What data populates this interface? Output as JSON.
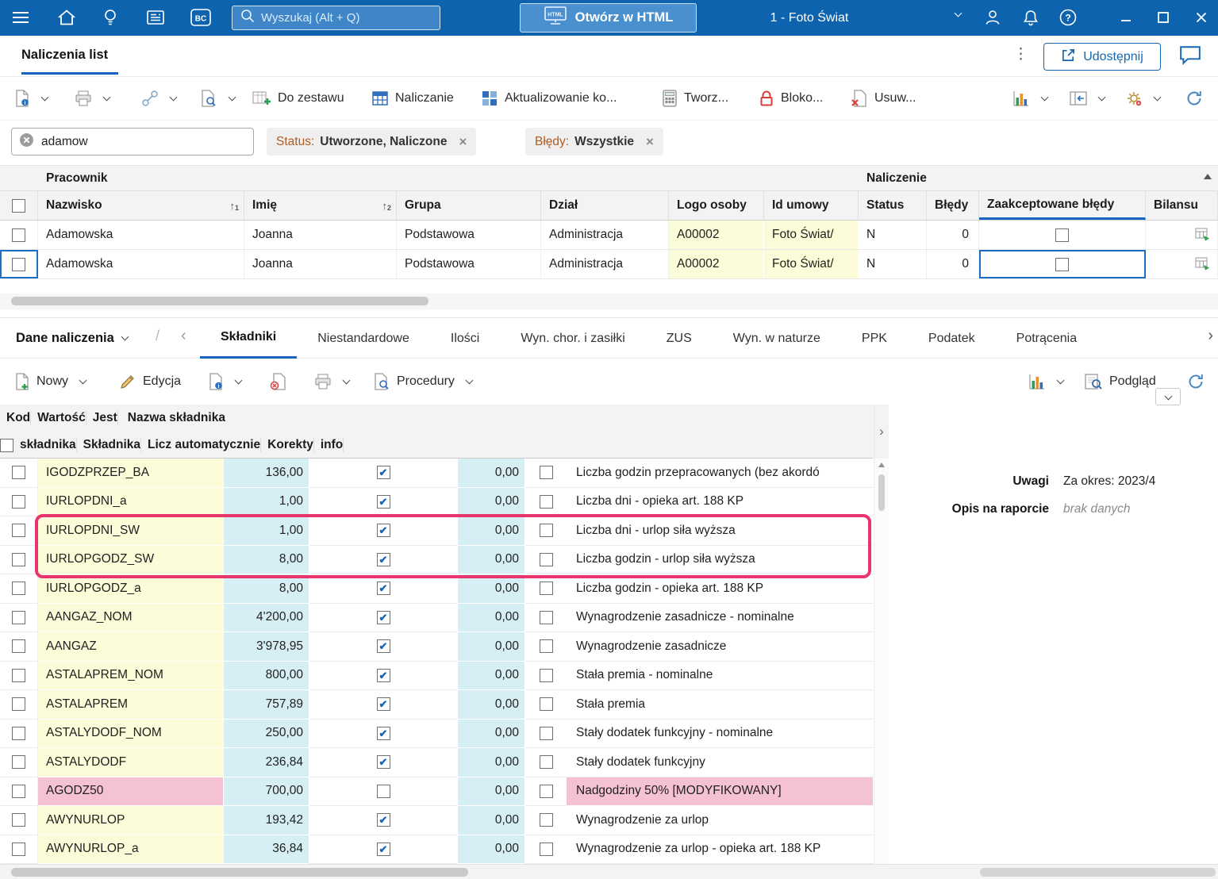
{
  "topbar": {
    "search": {
      "placeholder": "Wyszukaj (Alt + Q)"
    },
    "open_html": "Otwórz w HTML",
    "company": "1 - Foto Świat"
  },
  "header": {
    "tab": "Naliczenia list",
    "share": "Udostępnij"
  },
  "toolbar": {
    "items": [
      "Do zestawu",
      "Naliczanie",
      "Aktualizowanie ko...",
      "Tworz...",
      "Bloko...",
      "Usuw..."
    ]
  },
  "filters": {
    "search_value": "adamow",
    "chips": [
      {
        "name": "Status:",
        "value": "Utworzone, Naliczone"
      },
      {
        "name": "Błędy:",
        "value": "Wszystkie"
      }
    ]
  },
  "employees": {
    "groups": {
      "pracownik": "Pracownik",
      "naliczenie": "Naliczenie"
    },
    "columns": {
      "nazwisko": "Nazwisko",
      "imie": "Imię",
      "grupa": "Grupa",
      "dzial": "Dział",
      "logo": "Logo osoby",
      "umowa": "Id umowy",
      "status": "Status",
      "bledy": "Błędy",
      "zaakceptowane": "Zaakceptowane błędy",
      "bilans": "Bilansu"
    },
    "rows": [
      {
        "nazwisko": "Adamowska",
        "imie": "Joanna",
        "grupa": "Podstawowa",
        "dzial": "Administracja",
        "logo": "A00002",
        "umowa": "Foto Świat/",
        "status": "N",
        "bledy": "0",
        "zaakceptowane_checked": false,
        "selected": false
      },
      {
        "nazwisko": "Adamowska",
        "imie": "Joanna",
        "grupa": "Podstawowa",
        "dzial": "Administracja",
        "logo": "A00002",
        "umowa": "Foto Świat/",
        "status": "N",
        "bledy": "0",
        "zaakceptowane_checked": false,
        "selected": true
      }
    ]
  },
  "detail": {
    "title": "Dane naliczenia",
    "tabs": [
      "Składniki",
      "Niestandardowe",
      "Ilości",
      "Wyn. chor. i zasiłki",
      "ZUS",
      "Wyn. w naturze",
      "PPK",
      "Podatek",
      "Potrącenia"
    ],
    "active_tab": "Składniki",
    "toolbar": {
      "nowy": "Nowy",
      "edycja": "Edycja",
      "procedury": "Procedury",
      "podglad": "Podgląd"
    }
  },
  "components": {
    "headers": {
      "kod1": "Kod",
      "kod2": "składnika",
      "wartosc": "Wartość",
      "skladnika": "Składnika",
      "licz": "Licz automatycznie",
      "korekty": "Korekty",
      "jest1": "Jest",
      "jest2": "info",
      "nazwa": "Nazwa składnika"
    },
    "rows": [
      {
        "kod": "IGODZPRZEP_BA",
        "wartosc": "136,00",
        "licz": true,
        "korekty": "0,00",
        "info": false,
        "nazwa": "Liczba godzin przepracowanych (bez akordó",
        "pink": false
      },
      {
        "kod": "IURLOPDNI_a",
        "wartosc": "1,00",
        "licz": true,
        "korekty": "0,00",
        "info": false,
        "nazwa": "Liczba dni - opieka art. 188 KP",
        "pink": false
      },
      {
        "kod": "IURLOPDNI_SW",
        "wartosc": "1,00",
        "licz": true,
        "korekty": "0,00",
        "info": false,
        "nazwa": "Liczba dni - urlop siła wyższa",
        "pink": false
      },
      {
        "kod": "IURLOPGODZ_SW",
        "wartosc": "8,00",
        "licz": true,
        "korekty": "0,00",
        "info": false,
        "nazwa": "Liczba godzin - urlop siła wyższa",
        "pink": false
      },
      {
        "kod": "IURLOPGODZ_a",
        "wartosc": "8,00",
        "licz": true,
        "korekty": "0,00",
        "info": false,
        "nazwa": "Liczba godzin - opieka art. 188 KP",
        "pink": false
      },
      {
        "kod": "AANGAZ_NOM",
        "wartosc": "4'200,00",
        "licz": true,
        "korekty": "0,00",
        "info": false,
        "nazwa": "Wynagrodzenie zasadnicze - nominalne",
        "pink": false
      },
      {
        "kod": "AANGAZ",
        "wartosc": "3'978,95",
        "licz": true,
        "korekty": "0,00",
        "info": false,
        "nazwa": "Wynagrodzenie zasadnicze",
        "pink": false
      },
      {
        "kod": "ASTALAPREM_NOM",
        "wartosc": "800,00",
        "licz": true,
        "korekty": "0,00",
        "info": false,
        "nazwa": "Stała premia - nominalne",
        "pink": false
      },
      {
        "kod": "ASTALAPREM",
        "wartosc": "757,89",
        "licz": true,
        "korekty": "0,00",
        "info": false,
        "nazwa": "Stała premia",
        "pink": false
      },
      {
        "kod": "ASTALYDODF_NOM",
        "wartosc": "250,00",
        "licz": true,
        "korekty": "0,00",
        "info": false,
        "nazwa": "Stały dodatek funkcyjny - nominalne",
        "pink": false
      },
      {
        "kod": "ASTALYDODF",
        "wartosc": "236,84",
        "licz": true,
        "korekty": "0,00",
        "info": false,
        "nazwa": "Stały dodatek funkcyjny",
        "pink": false
      },
      {
        "kod": "AGODZ50",
        "wartosc": "700,00",
        "licz": false,
        "korekty": "0,00",
        "info": false,
        "nazwa": "Nadgodziny 50% [MODYFIKOWANY]",
        "pink": true
      },
      {
        "kod": "AWYNURLOP",
        "wartosc": "193,42",
        "licz": true,
        "korekty": "0,00",
        "info": false,
        "nazwa": "Wynagrodzenie za urlop",
        "pink": false
      },
      {
        "kod": "AWYNURLOP_a",
        "wartosc": "36,84",
        "licz": true,
        "korekty": "0,00",
        "info": false,
        "nazwa": "Wynagrodzenie za urlop - opieka art. 188 KP",
        "pink": false
      }
    ],
    "highlighted_rows": [
      2,
      3
    ]
  },
  "side_panel": {
    "uwagi_label": "Uwagi",
    "uwagi_value": "Za okres: 2023/4",
    "opis_label": "Opis na raporcie",
    "opis_value": "brak danych"
  },
  "colors": {
    "topbar": "#0e63ae",
    "accent": "#1565c0",
    "highlight": "#e8356d",
    "cell_yellow": "#fdfcd9",
    "cell_cyan": "#d6eff5",
    "cell_pink": "#f5c2d1"
  }
}
